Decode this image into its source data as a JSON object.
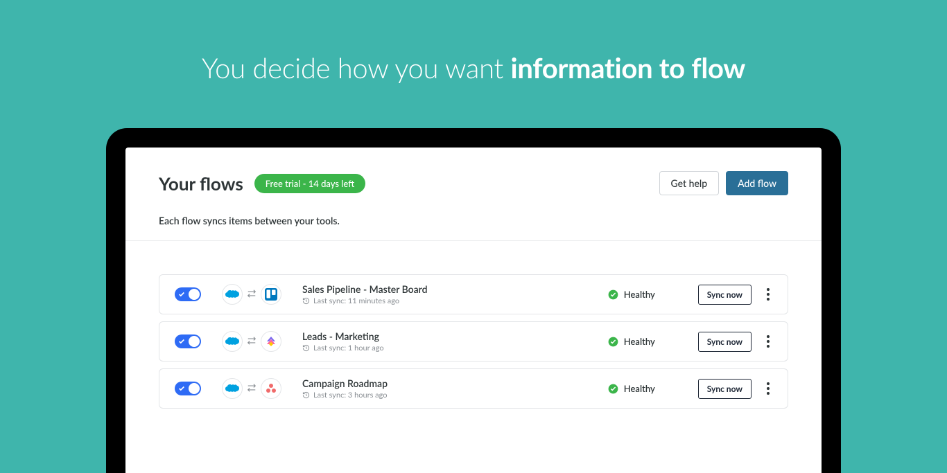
{
  "headline": {
    "prefix": "You decide how you want ",
    "bold": "information to flow"
  },
  "header": {
    "title": "Your flows",
    "trial_badge": "Free trial - 14 days left",
    "get_help_label": "Get help",
    "add_flow_label": "Add flow",
    "subtitle": "Each flow syncs items between your tools."
  },
  "flows": [
    {
      "name": "Sales Pipeline - Master Board",
      "last_sync": "Last sync: 11 minutes ago",
      "status": "Healthy",
      "sync_label": "Sync now",
      "source_icon": "salesforce",
      "target_icon": "trello"
    },
    {
      "name": "Leads - Marketing",
      "last_sync": "Last sync: 1 hour ago",
      "status": "Healthy",
      "sync_label": "Sync now",
      "source_icon": "salesforce",
      "target_icon": "clickup"
    },
    {
      "name": "Campaign Roadmap",
      "last_sync": "Last sync: 3 hours ago",
      "status": "Healthy",
      "sync_label": "Sync now",
      "source_icon": "salesforce",
      "target_icon": "asana"
    }
  ]
}
